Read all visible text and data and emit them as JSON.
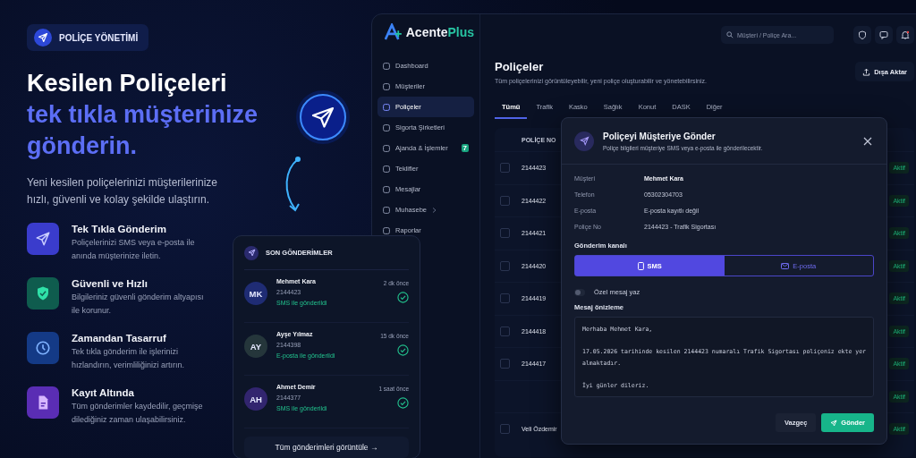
{
  "hero": {
    "badge": "POLİÇE YÖNETİMİ",
    "headline": "Kesilen Poliçeleri",
    "headline_accent": "tek tıkla müşterinize gönderin.",
    "description": "Yeni kesilen poliçelerinizi müşterilerinize hızlı, güvenli ve kolay şekilde ulaştırın.",
    "features": [
      {
        "kind": "send",
        "color": "#3a3ccc",
        "title": "Tek Tıkla Gönderim",
        "text": "Poliçelerinizi SMS veya e-posta ile anında müşterinize iletin."
      },
      {
        "kind": "shield",
        "color": "#0f5c4e",
        "title": "Güvenli ve Hızlı",
        "text": "Bilgileriniz güvenli gönderim altyapısı ile korunur."
      },
      {
        "kind": "clock",
        "color": "#143a86",
        "title": "Zamandan Tasarruf",
        "text": "Tek tıkla gönderim ile işlerinizi hızlandırın, verimliliğinizi artırın."
      },
      {
        "kind": "document",
        "color": "#5a2db4",
        "title": "Kayıt Altında",
        "text": "Tüm gönderimler kaydedilir, geçmişe dilediğiniz zaman ulaşabilirsiniz."
      }
    ]
  },
  "recent": {
    "title": "SON GÖNDERİMLER",
    "items": [
      {
        "initials": "MK",
        "color": "#1f2c74",
        "name": "Mehmet Kara",
        "policy_no": "2144423",
        "status": "SMS ile gönderildi",
        "time": "2 dk önce"
      },
      {
        "initials": "AY",
        "color": "#25363b",
        "name": "Ayşe Yılmaz",
        "policy_no": "2144398",
        "status": "E-posta ile gönderildi",
        "time": "15 dk önce"
      },
      {
        "initials": "AH",
        "color": "#32256f",
        "name": "Ahmet Demir",
        "policy_no": "2144377",
        "status": "SMS ile gönderildi",
        "time": "1 saat önce"
      }
    ],
    "footer_button": "Tüm gönderimleri görüntüle →"
  },
  "app": {
    "logo": "Acente",
    "logo_accent": "Plus",
    "sidebar": [
      {
        "label": "Dashboard",
        "selected": false
      },
      {
        "label": "Müşteriler",
        "selected": false
      },
      {
        "label": "Poliçeler",
        "selected": true
      },
      {
        "label": "Sigorta Şirketleri",
        "selected": false
      },
      {
        "label": "Ajanda & İşlemler",
        "selected": false,
        "badge": "7"
      },
      {
        "label": "Teklifler",
        "selected": false
      },
      {
        "label": "Mesajlar",
        "selected": false
      },
      {
        "label": "Muhasebe",
        "selected": false,
        "has_submenu": true
      },
      {
        "label": "Raporlar",
        "selected": false
      }
    ],
    "search": {
      "placeholder": "Müşteri / Poliçe Ara..."
    },
    "title": "Poliçeler",
    "subtitle": "Tüm poliçelerinizi görüntüleyebilir, yeni poliçe oluşturabilir ve yönetebilirsiniz.",
    "export_button": "Dışa Aktar",
    "tabs": [
      {
        "label": "Tümü",
        "selected": true
      },
      {
        "label": "Trafik",
        "selected": false
      },
      {
        "label": "Kasko",
        "selected": false
      },
      {
        "label": "Sağlık",
        "selected": false
      },
      {
        "label": "Konut",
        "selected": false
      },
      {
        "label": "DASK",
        "selected": false
      },
      {
        "label": "Diğer",
        "selected": false
      }
    ],
    "table": {
      "columns": [
        "POLİÇE NO"
      ],
      "rows": [
        {
          "checked": false,
          "policy_no": "2144423",
          "status": "Aktif"
        },
        {
          "checked": false,
          "policy_no": "2144422",
          "status": "Aktif"
        },
        {
          "checked": false,
          "policy_no": "2144421",
          "status": "Aktif"
        },
        {
          "checked": false,
          "policy_no": "2144420",
          "status": "Aktif"
        },
        {
          "checked": false,
          "policy_no": "2144419",
          "status": "Aktif"
        },
        {
          "checked": false,
          "policy_no": "2144418",
          "status": "Aktif"
        },
        {
          "checked": false,
          "policy_no": "2144417",
          "status": "Aktif"
        },
        {
          "status": "Aktif"
        },
        {
          "checked": false,
          "policy_no": "Veli Özdemir",
          "status": "Aktif"
        }
      ]
    }
  },
  "modal": {
    "title": "Poliçeyi Müşteriye Gönder",
    "subtitle": "Poliçe bilgileri müşteriye SMS veya e-posta ile gönderilecektir.",
    "fields": [
      {
        "label": "Müşteri",
        "value": "Mehmet Kara",
        "strong": true
      },
      {
        "label": "Telefon",
        "value": "05302304703",
        "strong": false
      },
      {
        "label": "E-posta",
        "value": "E-posta kayıtlı değil",
        "strong": false
      },
      {
        "label": "Poliçe No",
        "value": "2144423 - Trafik Sigortası",
        "strong": false
      }
    ],
    "channel_label": "Gönderim kanalı",
    "channels": [
      {
        "kind": "phone",
        "label": "SMS",
        "selected": true
      },
      {
        "kind": "mail",
        "label": "E-posta",
        "selected": false
      }
    ],
    "custom_message": {
      "label": "Özel mesaj yaz",
      "on": false
    },
    "preview_label": "Mesaj önizleme",
    "preview": "Merhaba Mehmet Kara,\n\n17.05.2026 tarihinde kesilen 2144423 numaralı Trafik Sigortası poliçeniz ekte yer almaktadır.\n\nİyi günler dileriz.",
    "cancel_button": "Vazgeç",
    "send_button": "Gönder"
  }
}
